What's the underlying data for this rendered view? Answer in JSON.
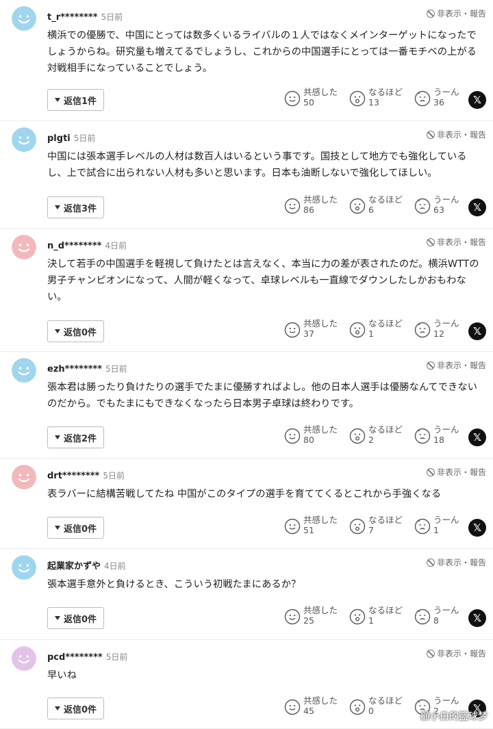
{
  "ui": {
    "hide_label": "非表示・報告",
    "react_sympathy": "共感した",
    "react_indeed": "なるほど",
    "react_hmm": "うーん",
    "x_label": "𝕏",
    "watermark": "顧小白的篮球梦"
  },
  "colors": {
    "avatar_blue": "#9fd6ee",
    "avatar_pink": "#f2b9bd",
    "avatar_lilac": "#e3c3e8"
  },
  "comments": [
    {
      "user": "t_r********",
      "time": "5日前",
      "avatar_color": "blue",
      "text": "横浜での優勝で、中国にとっては数多くいるライバルの１人ではなくメインターゲットになったでしょうからね。研究量も増えてるでしょうし、これからの中国選手にとっては一番モチベの上がる対戦相手になっていることでしょう。",
      "reply_label": "返信1件",
      "sympathy": "50",
      "indeed": "13",
      "hmm": "36"
    },
    {
      "user": "plgti",
      "time": "5日前",
      "avatar_color": "blue",
      "text": "中国には張本選手レベルの人材は数百人はいるという事です。国技として地方でも強化しているし、上で試合に出られない人材も多いと思います。日本も油断しないで強化してほしい。",
      "reply_label": "返信3件",
      "sympathy": "86",
      "indeed": "6",
      "hmm": "63"
    },
    {
      "user": "n_d********",
      "time": "4日前",
      "avatar_color": "pink",
      "text": "決して若手の中国選手を軽視して負けたとは言えなく、本当に力の差が表されたのだ。横浜WTTの男子チャンピオンになって、人間が軽くなって、卓球レベルも一直線でダウンしたしかおもわない。",
      "reply_label": "返信0件",
      "sympathy": "37",
      "indeed": "1",
      "hmm": "12"
    },
    {
      "user": "ezh********",
      "time": "5日前",
      "avatar_color": "blue",
      "text": "張本君は勝ったり負けたりの選手でたまに優勝すればよし。他の日本人選手は優勝なんてできないのだから。でもたまにもできなくなったら日本男子卓球は終わりです。",
      "reply_label": "返信2件",
      "sympathy": "80",
      "indeed": "2",
      "hmm": "18"
    },
    {
      "user": "drt********",
      "time": "5日前",
      "avatar_color": "pink",
      "text": "表ラバーに結構苦戦してたね 中国がこのタイプの選手を育ててくるとこれから手強くなる",
      "reply_label": "返信0件",
      "sympathy": "51",
      "indeed": "7",
      "hmm": "1"
    },
    {
      "user": "起業家かずや",
      "time": "4日前",
      "avatar_color": "blue",
      "text": "張本選手意外と負けるとき、こういう初戦たまにあるか？",
      "reply_label": "返信0件",
      "sympathy": "25",
      "indeed": "1",
      "hmm": "8"
    },
    {
      "user": "pcd********",
      "time": "5日前",
      "avatar_color": "lilac",
      "text": "早いね",
      "reply_label": "返信0件",
      "sympathy": "45",
      "indeed": "0",
      "hmm": "2"
    }
  ]
}
